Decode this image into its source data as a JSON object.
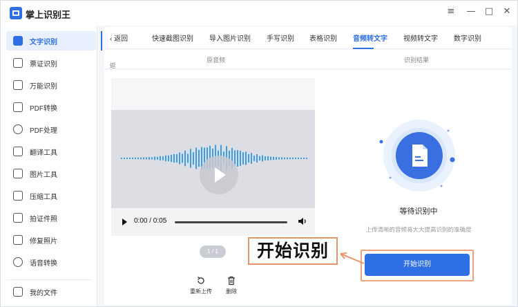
{
  "app": {
    "title": "掌上识别王"
  },
  "window_controls": [
    "≡",
    "—",
    "□",
    "✕"
  ],
  "sidebar": {
    "items": [
      {
        "label": "文字识别",
        "icon": "text-recognition-icon",
        "active": true
      },
      {
        "label": "票证识别",
        "icon": "ticket-icon"
      },
      {
        "label": "万能识别",
        "icon": "universal-scan-icon"
      },
      {
        "label": "PDF转换",
        "icon": "pdf-convert-icon"
      },
      {
        "label": "PDF处理",
        "icon": "pdf-process-icon"
      },
      {
        "label": "翻译工具",
        "icon": "translate-icon"
      },
      {
        "label": "图片工具",
        "icon": "image-tool-icon"
      },
      {
        "label": "压缩工具",
        "icon": "compress-icon"
      },
      {
        "label": "拍证件照",
        "icon": "id-photo-icon"
      },
      {
        "label": "修复照片",
        "icon": "repair-photo-icon"
      },
      {
        "label": "语音转换",
        "icon": "voice-convert-icon"
      }
    ],
    "footer": {
      "label": "我的文件",
      "icon": "my-files-icon"
    }
  },
  "tabs": {
    "back": "返回",
    "items": [
      "快速截图识别",
      "导入图片识别",
      "手写识别",
      "表格识别",
      "音频转文字",
      "视频转文字",
      "数字识别"
    ],
    "active": "音频转文字"
  },
  "subbar": {
    "back": "返回",
    "left_title": "原音频",
    "right_title": "识别结果"
  },
  "player": {
    "time": "0:00 / 0:05",
    "progress": 0
  },
  "pager": "1 / 1",
  "actions": {
    "reupload": "重新上传",
    "delete": "删除"
  },
  "status": {
    "title": "等待识别中",
    "subtitle": "上传清晰的音频将大大提高识别的准确度"
  },
  "start_button": "开始识别",
  "callout": "开始识别",
  "colors": {
    "accent": "#2f6fe4",
    "annotation": "#e8936a",
    "wave": "#3a9ee0"
  }
}
